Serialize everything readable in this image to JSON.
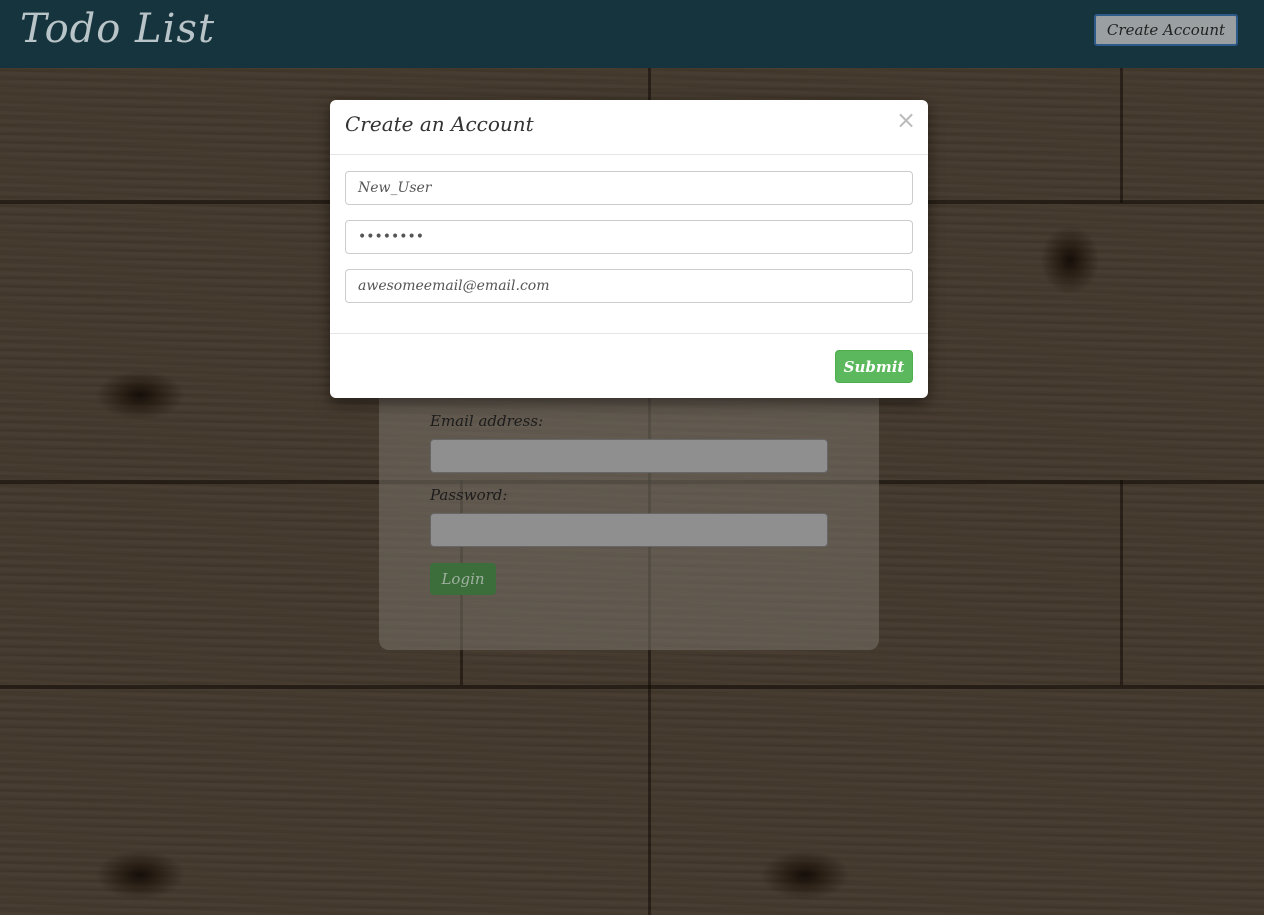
{
  "navbar": {
    "brand": "Todo List",
    "create_account_label": "Create Account"
  },
  "login": {
    "email_label": "Email address:",
    "password_label": "Password:",
    "login_label": "Login"
  },
  "modal": {
    "title": "Create an Account",
    "close_symbol": "×",
    "username_value": "New_User",
    "password_value": "••••••••",
    "email_value": "awesomeemail@email.com",
    "submit_label": "Submit"
  },
  "colors": {
    "navbar": "#16343d",
    "submit": "#5cb85c"
  }
}
